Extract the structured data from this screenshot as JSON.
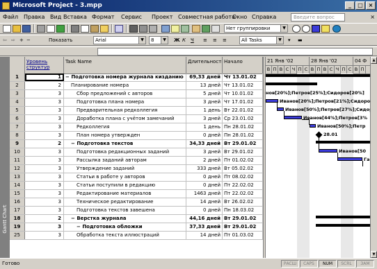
{
  "window": {
    "title": "Microsoft Project - 3.mpp"
  },
  "menu": {
    "items": [
      "Файл",
      "Правка",
      "Вид",
      "Вставка",
      "Формат",
      "Сервис",
      "Проект",
      "Совместная работа",
      "Окно",
      "Справка"
    ],
    "ask_placeholder": "Введите вопрос"
  },
  "toolbar": {
    "group_combo": "Нет группировки",
    "font_combo": "Arial",
    "size_combo": "8",
    "show_label": "Показать",
    "filter_combo": "All Tasks"
  },
  "viewbar": {
    "label": "Gantt Chart"
  },
  "table": {
    "headers": {
      "id": "",
      "level": "Уровень структур",
      "name": "Task Name",
      "duration": "Длительность",
      "start": "Начало"
    },
    "rows": [
      {
        "id": "1",
        "level": "1",
        "name": "Подготовка номера журнала кизданию",
        "duration": "69,33 дней",
        "start": "Чт 13.01.02",
        "summary": true
      },
      {
        "id": "2",
        "level": "2",
        "name": "Планирование номера",
        "duration": "13 дней",
        "start": "Чт 13.01.02",
        "summary": false
      },
      {
        "id": "3",
        "level": "3",
        "name": "Сбор предложений с авторов",
        "duration": "5 дней",
        "start": "Чт 10.01.02",
        "summary": false
      },
      {
        "id": "4",
        "level": "3",
        "name": "Подготовка плана номера",
        "duration": "3 дней",
        "start": "Чт 17.01.02",
        "summary": false
      },
      {
        "id": "5",
        "level": "3",
        "name": "Предварительная редколлегия",
        "duration": "1 день",
        "start": "Вт 22.01.02",
        "summary": false
      },
      {
        "id": "6",
        "level": "3",
        "name": "Доработка плана с учётом замечаний",
        "duration": "3 дней",
        "start": "Ср 23.01.02",
        "summary": false
      },
      {
        "id": "7",
        "level": "3",
        "name": "Редколлегия",
        "duration": "1 день",
        "start": "Пн 28.01.02",
        "summary": false
      },
      {
        "id": "8",
        "level": "3",
        "name": "План номера утвержден",
        "duration": "0 дней",
        "start": "Пн 28.01.02",
        "summary": false
      },
      {
        "id": "9",
        "level": "2",
        "name": "Подготовка текстов",
        "duration": "34,33 дней",
        "start": "Вт 29.01.02",
        "summary": true
      },
      {
        "id": "10",
        "level": "3",
        "name": "Подготовка редакционных заданий",
        "duration": "3 дней",
        "start": "Вт 29.01.02",
        "summary": false
      },
      {
        "id": "11",
        "level": "3",
        "name": "Рассылка заданий авторам",
        "duration": "2 дней",
        "start": "Пт 01.02.02",
        "summary": false
      },
      {
        "id": "12",
        "level": "3",
        "name": "Утверждение заданий",
        "duration": "333 дней",
        "start": "Вт 05.02.02",
        "summary": false
      },
      {
        "id": "13",
        "level": "3",
        "name": "Статьи в работе у авторов",
        "duration": "0 дней",
        "start": "Пт 08.02.02",
        "summary": false
      },
      {
        "id": "14",
        "level": "3",
        "name": "Статьи поступили в редакцию",
        "duration": "0 дней",
        "start": "Пт 22.02.02",
        "summary": false
      },
      {
        "id": "15",
        "level": "3",
        "name": "Редактирование материалов",
        "duration": "1463 дней",
        "start": "Пт 22.02.02",
        "summary": false
      },
      {
        "id": "16",
        "level": "3",
        "name": "Техническое редактирование",
        "duration": "14 дней",
        "start": "Вт 26.02.02",
        "summary": false
      },
      {
        "id": "17",
        "level": "3",
        "name": "Подготовка текстов завешена",
        "duration": "0 дней",
        "start": "Пн 18.03.02",
        "summary": false
      },
      {
        "id": "18",
        "level": "2",
        "name": "Верстка журнала",
        "duration": "44,16 дней",
        "start": "Вт 29.01.02",
        "summary": true
      },
      {
        "id": "19",
        "level": "3",
        "name": "Подготовка обложки",
        "duration": "37,33 дней",
        "start": "Вт 29.01.02",
        "summary": true
      },
      {
        "id": "25",
        "level": "3",
        "name": "Обработка текста иллюстраций",
        "duration": "14 дней",
        "start": "Пт 01.03.02",
        "summary": false
      }
    ]
  },
  "gantt": {
    "weeks": [
      "21 Янв '02",
      "28 Янв '02",
      "04 Ф"
    ],
    "days": [
      "В",
      "П",
      "В",
      "С",
      "Ч",
      "П",
      "С",
      "В",
      "П",
      "В",
      "С",
      "Ч",
      "П",
      "С",
      "В",
      "П"
    ],
    "labels": {
      "r3": "нов[20%];Петров[25%];Сидоров[20%]",
      "r4": "Иванов[20%];Петров[21%];Сидоро",
      "r5": "Иванов[50%];Петров[27%];Сидор",
      "r6": "Иванов[44%];Петров[3%",
      "r7": "Иванов[50%];Петр",
      "r8": "28.01",
      "r10": "Иванов[50",
      "r11": "Га"
    }
  },
  "status": {
    "ready": "Готово",
    "indicators": [
      "РАСШ",
      "CAPS",
      "NUM",
      "SCRL",
      "ЗАМ"
    ]
  }
}
